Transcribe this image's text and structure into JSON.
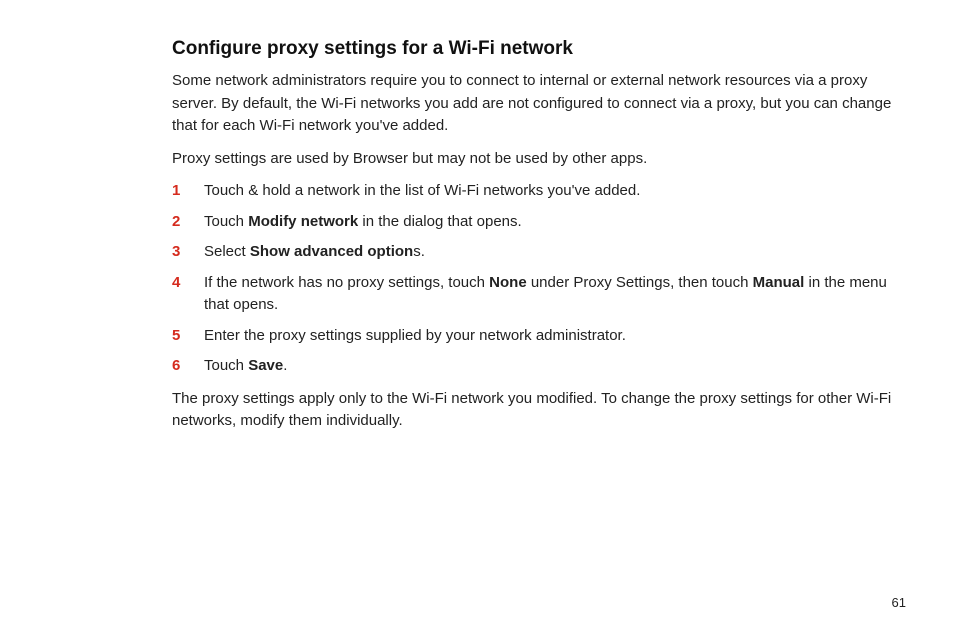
{
  "title": "Configure proxy settings for a Wi-Fi network",
  "intro1": "Some network administrators require you to connect to internal or external network resources via a proxy server. By default, the Wi-Fi networks you add are not configured to connect via a proxy, but you can change that for each Wi-Fi network you've added.",
  "intro2": "Proxy settings are used by Browser but may not be used by other apps.",
  "steps": [
    {
      "n": "1",
      "pre": "Touch & hold a network in the list of Wi-Fi networks you've added.",
      "b1": "",
      "mid": "",
      "b2": "",
      "post": ""
    },
    {
      "n": "2",
      "pre": "Touch ",
      "b1": "Modify network",
      "mid": " in the dialog that opens.",
      "b2": "",
      "post": ""
    },
    {
      "n": "3",
      "pre": "Select ",
      "b1": "Show advanced option",
      "mid": "s.",
      "b2": "",
      "post": ""
    },
    {
      "n": "4",
      "pre": "If the network has no proxy settings, touch ",
      "b1": "None",
      "mid": " under Proxy Settings, then touch ",
      "b2": "Manual",
      "post": " in the menu that opens."
    },
    {
      "n": "5",
      "pre": "Enter the proxy settings supplied by your network administrator.",
      "b1": "",
      "mid": "",
      "b2": "",
      "post": ""
    },
    {
      "n": "6",
      "pre": "Touch ",
      "b1": "Save",
      "mid": ".",
      "b2": "",
      "post": ""
    }
  ],
  "outro": "The proxy settings apply only to the Wi-Fi network you modified. To change the proxy settings for other Wi-Fi networks, modify them individually.",
  "page_number": "61"
}
